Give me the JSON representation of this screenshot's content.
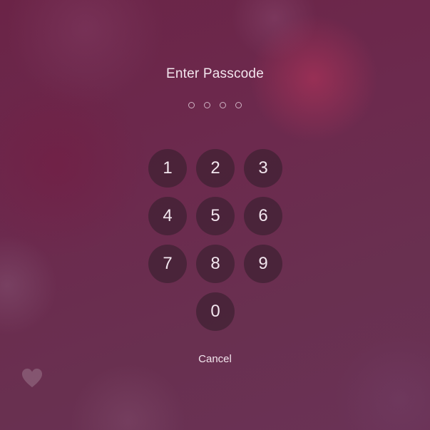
{
  "lock_screen": {
    "title": "Enter Passcode",
    "passcode_length": 4,
    "entered_digits": 0,
    "keys": [
      "1",
      "2",
      "3",
      "4",
      "5",
      "6",
      "7",
      "8",
      "9",
      "0"
    ],
    "cancel_label": "Cancel"
  },
  "colors": {
    "background": "#6a2a4c",
    "key_background": "rgba(55,30,45,0.62)",
    "text": "#f3e6ee"
  },
  "icons": {
    "passcode_dot": "empty-circle",
    "wallpaper_heart": "heart-icon"
  }
}
